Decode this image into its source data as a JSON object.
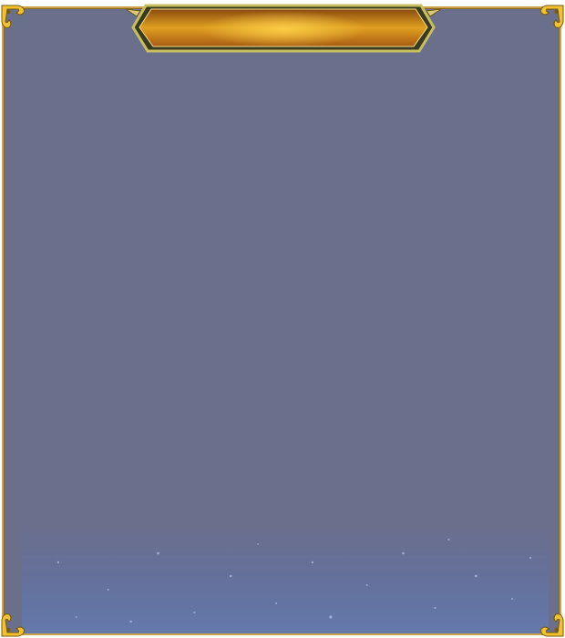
{
  "panel": {
    "title": "",
    "background_color": "#6a6f8c",
    "border_color": "#c9a24a"
  },
  "title_plaque": {
    "fill_top": "#8a4a10",
    "fill_mid": "#e0a020",
    "frame_color": "#c8c060"
  },
  "ornaments": {
    "corner_icon": "gold-scroll-ornament-icon"
  }
}
